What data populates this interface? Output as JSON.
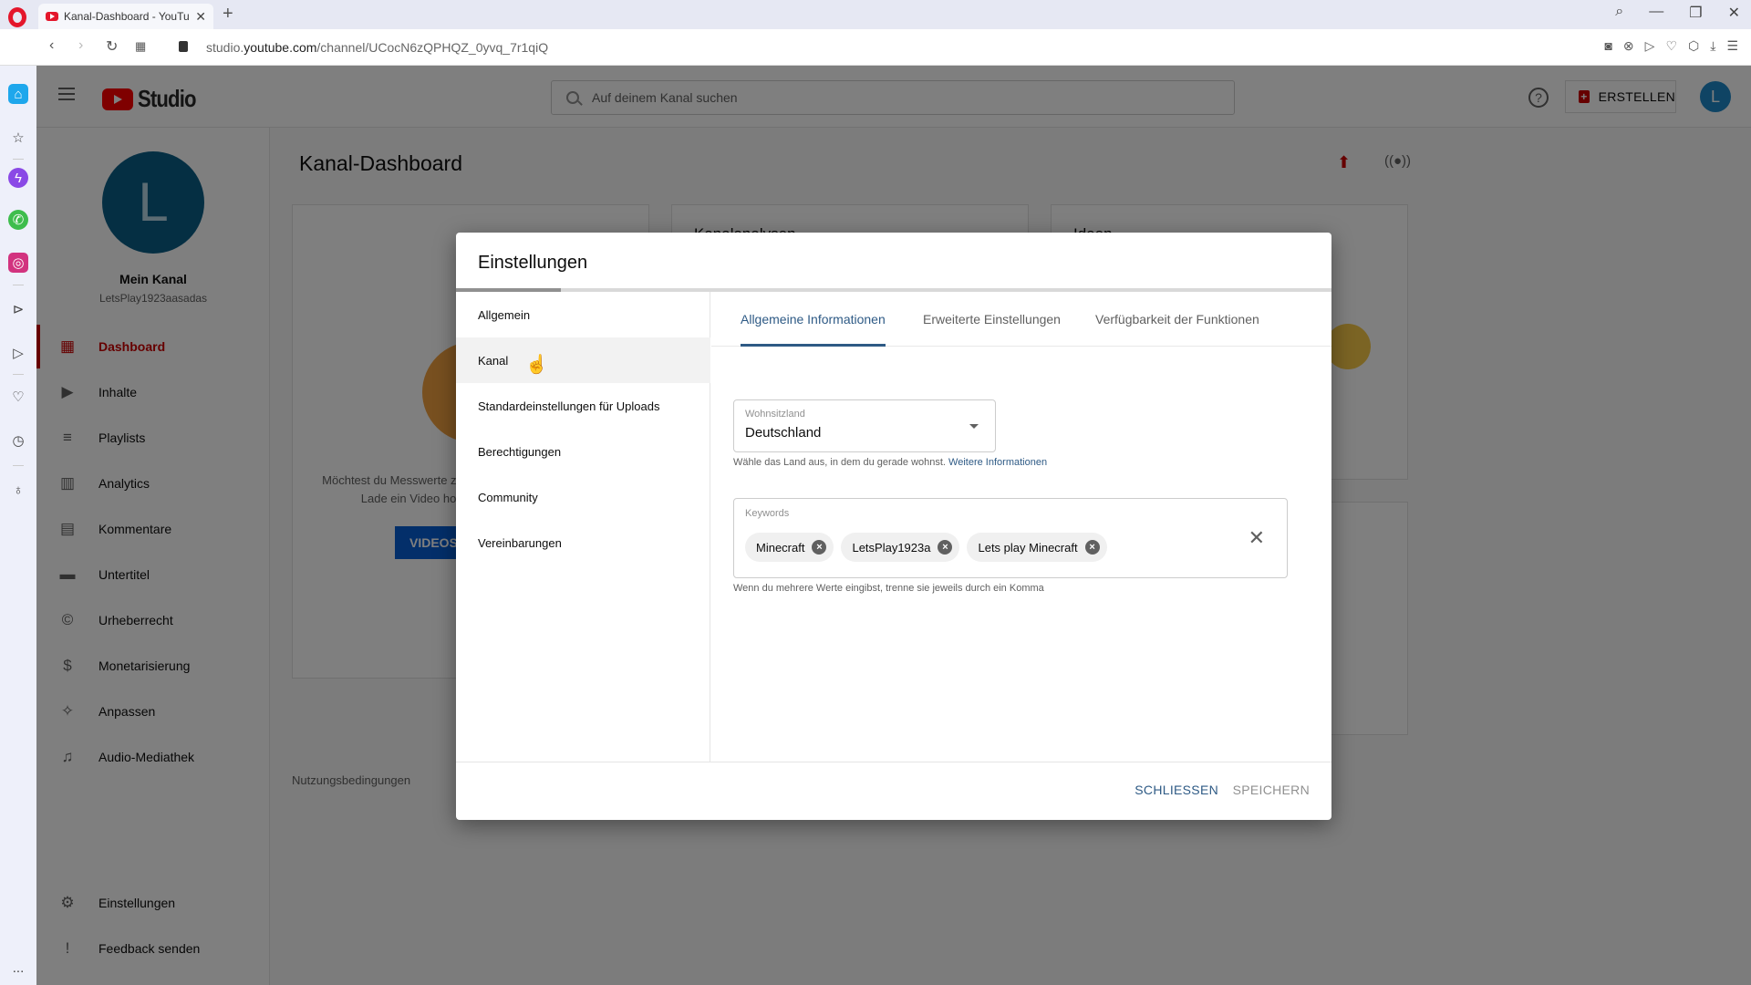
{
  "browser": {
    "tab_title": "Kanal-Dashboard - YouTube Studio",
    "new_tab": "+",
    "url_domain": "studio.youtube.com",
    "url_path": "/channel/UCocN6zQPHQZ_0yvq_7r1qiQ",
    "url_prefix": "studio.",
    "url_host": "youtube.com",
    "window_controls": [
      "search",
      "minimize",
      "restore",
      "close"
    ]
  },
  "opera_sidebar": {
    "icons": [
      "home-icon",
      "star-icon",
      "messenger-icon",
      "whatsapp-icon",
      "instagram-icon",
      "player-icon",
      "send-icon",
      "heart-icon",
      "history-icon",
      "lightbulb-icon"
    ],
    "more": "..."
  },
  "topbar": {
    "logo_text": "Studio",
    "search_placeholder": "Auf deinem Kanal suchen",
    "help": "?",
    "create_label": "ERSTELLEN",
    "avatar_letter": "L"
  },
  "leftnav": {
    "avatar_letter": "L",
    "channel_name": "Mein Kanal",
    "channel_handle": "LetsPlay1923aasadas",
    "items": [
      {
        "label": "Dashboard",
        "icon": "dashboard-icon",
        "active": true
      },
      {
        "label": "Inhalte",
        "icon": "content-icon"
      },
      {
        "label": "Playlists",
        "icon": "playlist-icon"
      },
      {
        "label": "Analytics",
        "icon": "analytics-icon"
      },
      {
        "label": "Kommentare",
        "icon": "comments-icon"
      },
      {
        "label": "Untertitel",
        "icon": "subtitles-icon"
      },
      {
        "label": "Urheberrecht",
        "icon": "copyright-icon"
      },
      {
        "label": "Monetarisierung",
        "icon": "dollar-icon"
      },
      {
        "label": "Anpassen",
        "icon": "magic-wand-icon"
      },
      {
        "label": "Audio-Mediathek",
        "icon": "audio-library-icon"
      }
    ],
    "bottom_items": [
      {
        "label": "Einstellungen",
        "icon": "gear-icon"
      },
      {
        "label": "Feedback senden",
        "icon": "feedback-icon"
      }
    ]
  },
  "main": {
    "page_title": "Kanal-Dashboard",
    "card1_text1": "Möchtest du Messwerte zu deinem letzten Video sehen?",
    "card1_text2": "Lade ein Video hoch und probiere es aus.",
    "card1_button": "VIDEOS HOCHLADEN",
    "card2_title": "Kanalanalysen",
    "card3_title": "Ideen",
    "terms": "Nutzungsbedingungen"
  },
  "dialog": {
    "title": "Einstellungen",
    "progress": 0.12,
    "nav": [
      "Allgemein",
      "Kanal",
      "Standardeinstellungen für Uploads",
      "Berechtigungen",
      "Community",
      "Vereinbarungen"
    ],
    "hovered_nav": "Kanal",
    "tabs": [
      "Allgemeine Informationen",
      "Erweiterte Einstellungen",
      "Verfügbarkeit der Funktionen"
    ],
    "active_tab": "Allgemeine Informationen",
    "country": {
      "label": "Wohnsitzland",
      "value": "Deutschland",
      "helper": "Wähle das Land aus, in dem du gerade wohnst.",
      "link": "Weitere Informationen"
    },
    "keywords": {
      "label": "Keywords",
      "chips": [
        "Minecraft",
        "LetsPlay1923a",
        "Lets play Minecraft"
      ],
      "helper": "Wenn du mehrere Werte eingibst, trenne sie jeweils durch ein Komma"
    },
    "close_label": "SCHLIESSEN",
    "save_label": "SPEICHERN"
  }
}
